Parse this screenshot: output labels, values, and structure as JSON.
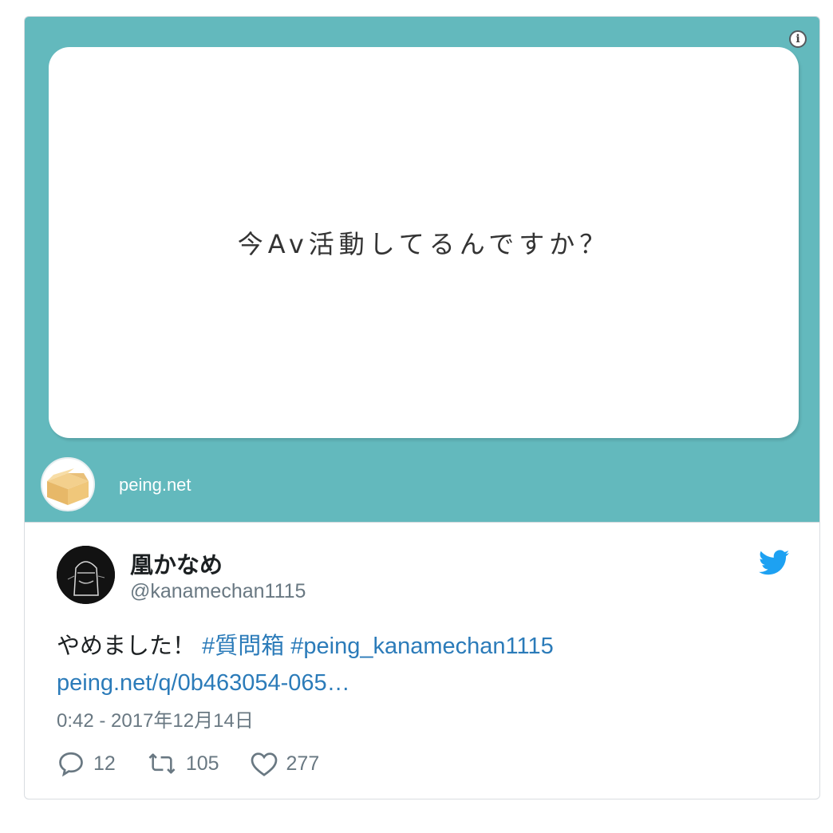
{
  "media": {
    "question": "今Av活動してるんですか？",
    "site_domain": "peing.net",
    "background_color": "#63b9bd",
    "info_icon": "info-icon"
  },
  "author": {
    "display_name": "凰かなめ",
    "handle": "@kanamechan1115"
  },
  "tweet": {
    "text_plain": "やめました！",
    "hashtag_1": "#質問箱",
    "hashtag_2": "#peing_kanamechan1115",
    "link": "peing.net/q/0b463054-065…",
    "timestamp": "0:42 - 2017年12月14日"
  },
  "actions": {
    "reply_count": "12",
    "retweet_count": "105",
    "like_count": "277"
  },
  "colors": {
    "link": "#2b7bb9",
    "twitter_blue": "#1da1f2",
    "muted_text": "#697882"
  }
}
